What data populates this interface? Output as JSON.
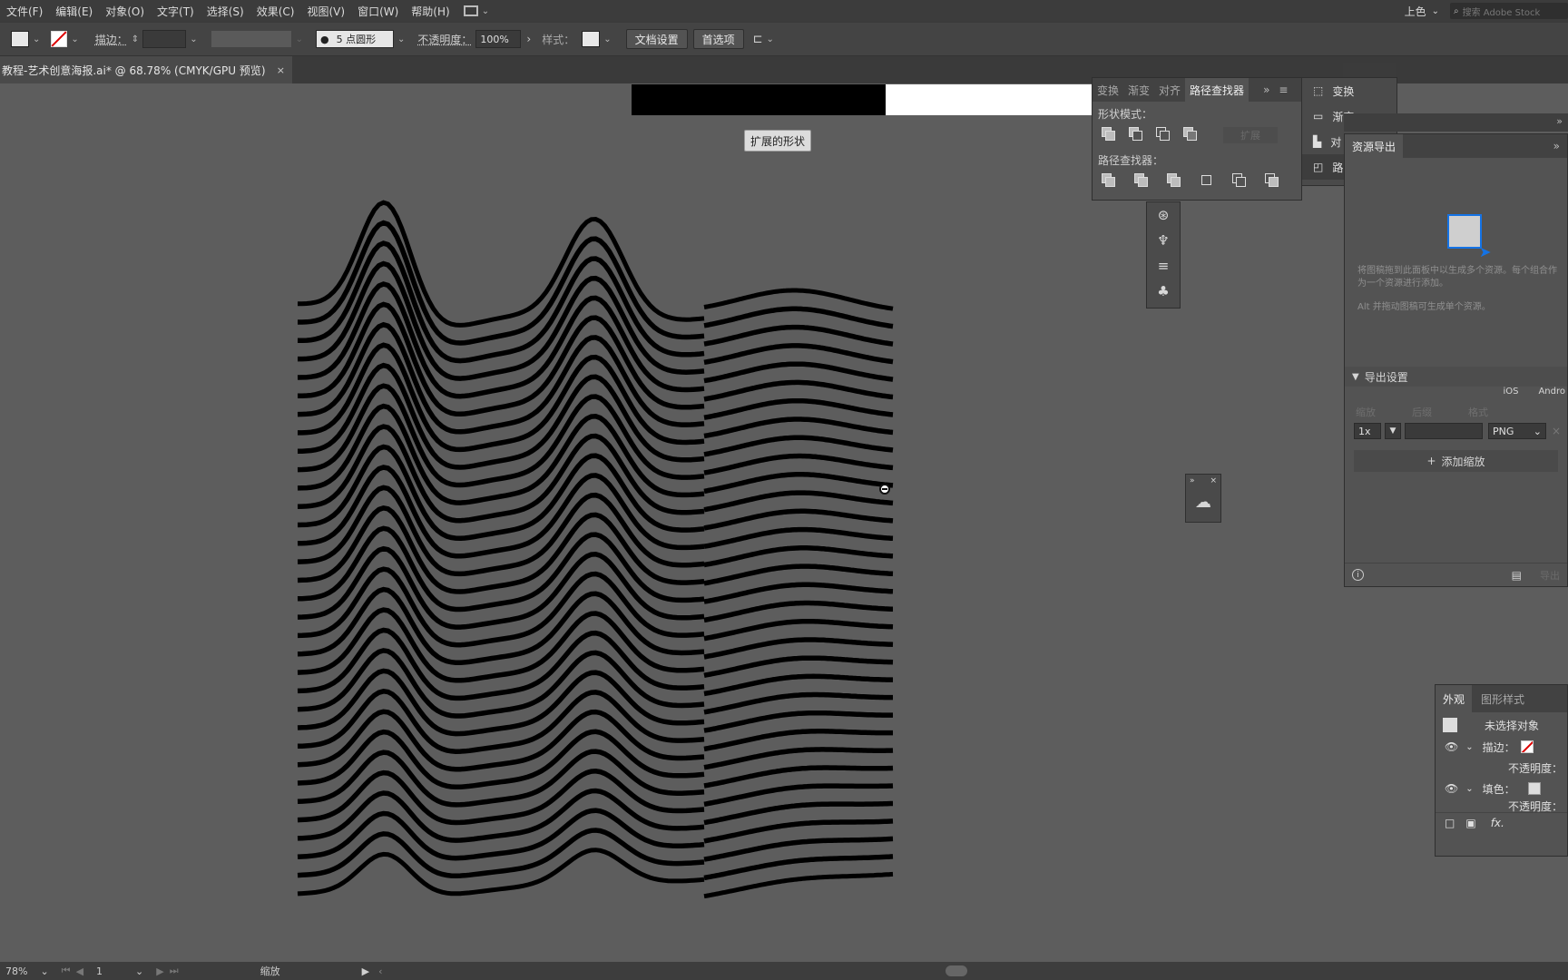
{
  "menu": [
    "文件(F)",
    "编辑(E)",
    "对象(O)",
    "文字(T)",
    "选择(S)",
    "效果(C)",
    "视图(V)",
    "窗口(W)",
    "帮助(H)"
  ],
  "menu_right": {
    "workspace": "上色",
    "stock_search": "搜索 Adobe Stock"
  },
  "control": {
    "stroke_label": "描边：",
    "brush": "5 点圆形",
    "opacity_label": "不透明度：",
    "opacity_value": "100%",
    "style_label": "样式：",
    "doc_settings": "文档设置",
    "preferences": "首选项"
  },
  "doc_tab": {
    "title": "教程-艺术创意海报.ai* @ 68.78% (CMYK/GPU 预览)",
    "close": "×"
  },
  "tooltip": "扩展的形状",
  "pathfinder": {
    "tabs": [
      "变换",
      "渐变",
      "对齐",
      "路径查找器"
    ],
    "shape_modes": "形状模式：",
    "expand": "扩展",
    "pathfinders": "路径查找器："
  },
  "side_panel": {
    "items": [
      "变换",
      "渐变",
      "对",
      "路"
    ]
  },
  "asset_export": {
    "title": "资源导出",
    "hint": "将图稿拖到此面板中以生成多个资源。每个组合作为一个资源进行添加。",
    "alt_hint": "Alt 并拖动图稿可生成单个资源。",
    "export_settings": "导出设置",
    "platforms": [
      "iOS",
      "Andro"
    ],
    "col_scale": "缩放",
    "col_suffix": "后缀",
    "col_format": "格式",
    "scale_value": "1x",
    "format_value": "PNG",
    "add_scale": "添加缩放",
    "export": "导出"
  },
  "appearance": {
    "tabs": [
      "外观",
      "图形样式"
    ],
    "no_selection": "未选择对象",
    "stroke": "描边：",
    "opacity": "不透明度：",
    "fill": "填色：",
    "opacity2": "不透明度：",
    "fx": "fx."
  },
  "status": {
    "zoom": "78%",
    "page": "1",
    "tool": "缩放"
  },
  "colors": {
    "app_bg": "#5d5d5d",
    "panel": "#535353",
    "accent_blue": "#1473e6"
  }
}
